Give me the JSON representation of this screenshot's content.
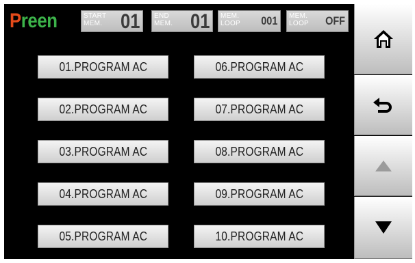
{
  "header": {
    "logo_initial": "P",
    "logo_rest": "reen",
    "start_mem": {
      "label_line1": "START",
      "label_line2": "MEM.",
      "value": "01"
    },
    "end_mem": {
      "label_line1": "END",
      "label_line2": "MEM.",
      "value": "01"
    },
    "mem_loop": {
      "label_line1": "MEM.",
      "label_line2": "LOOP",
      "value": "001"
    },
    "mem_loop_state": {
      "label_line1": "MEM.",
      "label_line2": "LOOP",
      "value": "OFF"
    }
  },
  "programs": [
    "01.PROGRAM AC",
    "02.PROGRAM AC",
    "03.PROGRAM AC",
    "04.PROGRAM AC",
    "05.PROGRAM AC",
    "06.PROGRAM AC",
    "07.PROGRAM AC",
    "08.PROGRAM AC",
    "09.PROGRAM AC",
    "10.PROGRAM AC"
  ],
  "side_buttons": {
    "home": "home-icon",
    "back": "return-arrow-icon",
    "up": "triangle-up-icon",
    "down": "triangle-down-icon"
  },
  "colors": {
    "logo_p": "#e34a1a",
    "logo_rest": "#3cb34a",
    "background": "#000000",
    "up_arrow_disabled": "#9b9b9b",
    "down_arrow": "#000000"
  }
}
